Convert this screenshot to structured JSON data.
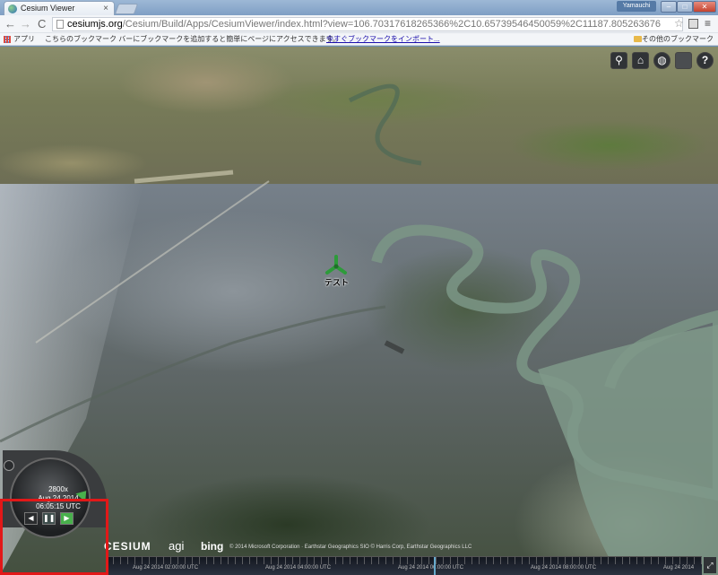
{
  "browser": {
    "tab_title": "Cesium Viewer",
    "tab_close": "×",
    "user_badge": "Yamauchi",
    "url_host": "cesiumjs.org",
    "url_path": "/Cesium/Build/Apps/CesiumViewer/index.html?view=106.70317618265366%2C10.65739546450059%2C11187.805263676",
    "nav_back": "←",
    "nav_forward": "→",
    "nav_reload": "C",
    "star": "☆",
    "menu": "≡",
    "window_min": "‒",
    "window_max": "□",
    "window_close": "✕"
  },
  "bookmarks": {
    "apps_label": "アプリ",
    "message": "こちらのブックマーク バーにブックマークを追加すると簡単にページにアクセスできます。",
    "import_link": "今すぐブックマークをインポート...",
    "other_label": "その他のブックマーク"
  },
  "cesium": {
    "toolbar": {
      "search": "⚲",
      "home": "⌂",
      "scene_mode": "◍",
      "help": "?"
    },
    "billboard_label": "テスト",
    "credits": {
      "cesium": "CESIUM",
      "agi": "agi",
      "bing": "bing",
      "text": "© 2014 Microsoft Corporation · Earthstar Geographics SIO © Harris Corp, Earthstar Geographics LLC"
    },
    "timeline": {
      "labels": [
        "Aug 24 2014 02:00:00 UTC",
        "Aug 24 2014 04:00:00 UTC",
        "Aug 24 2014 06:00:00 UTC",
        "Aug 24 2014 08:00:00 UTC",
        "Aug 24 2014"
      ]
    },
    "animation": {
      "speed": "2800x",
      "date": "Aug 24 2014",
      "time": "06:05:15 UTC",
      "reverse": "◀",
      "pause": "❚❚",
      "play": "▶"
    },
    "fullscreen": "⤢"
  }
}
